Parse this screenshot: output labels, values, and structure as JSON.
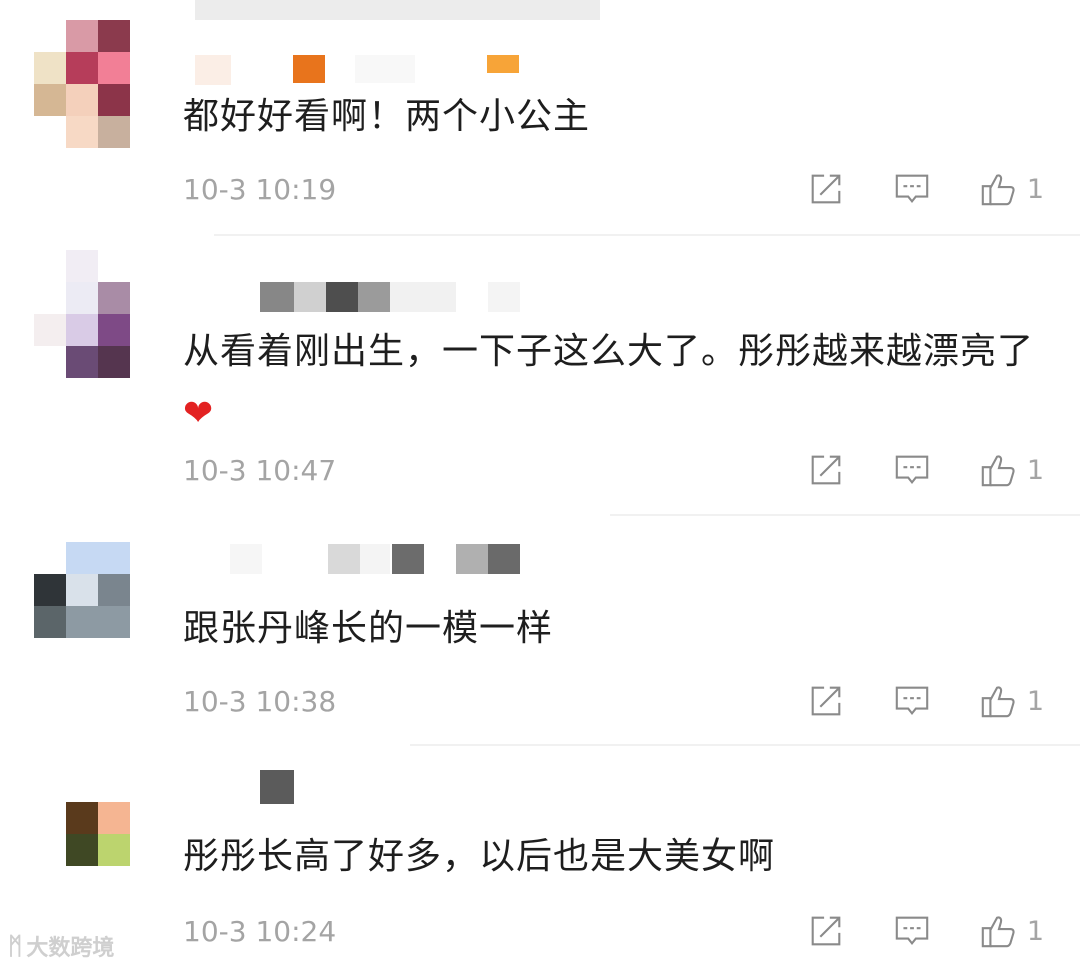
{
  "comments": [
    {
      "text": "都好好看啊！两个小公主",
      "time": "10-3 10:19",
      "likes": "1"
    },
    {
      "text": "从看着刚出生，一下子这么大了。彤彤越来越漂亮了",
      "emoji": "❤",
      "time": "10-3 10:47",
      "likes": "1"
    },
    {
      "text": "跟张丹峰长的一模一样",
      "time": "10-3 10:38",
      "likes": "1"
    },
    {
      "text": "彤彤长高了好多，以后也是大美女啊",
      "time": "10-3 10:24",
      "likes": "1"
    }
  ],
  "watermark": {
    "logo": "ᛗ",
    "text": "大数跨境"
  },
  "icons": [
    "share-icon",
    "reply-icon",
    "thumbs-up-icon"
  ],
  "colors": {
    "meta": "#a4a4a4",
    "text": "#1e1e1e",
    "heart": "#e32222"
  }
}
